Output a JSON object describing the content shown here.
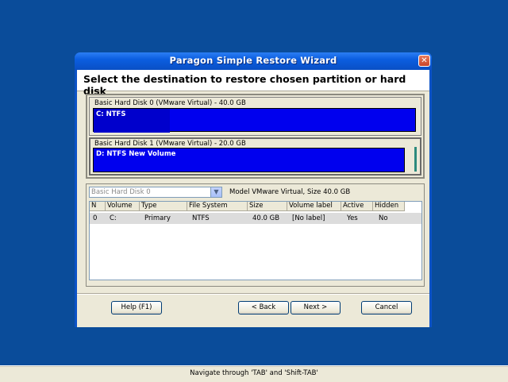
{
  "window": {
    "title": "Paragon Simple Restore Wizard",
    "close_glyph": "✕",
    "heading": "Select the destination to restore chosen partition or hard disk"
  },
  "disks": [
    {
      "label": "Basic Hard Disk 0 (VMware Virtual) - 40.0 GB",
      "partition": "C:  NTFS"
    },
    {
      "label": "Basic Hard Disk 1 (VMware Virtual) - 20.0 GB",
      "partition": "D:  NTFS New Volume"
    }
  ],
  "disk_select": {
    "value": "Basic Hard Disk 0",
    "arrow_icon": "chevron-down-icon",
    "arrow_glyph": "▼"
  },
  "model_info": "Model VMware Virtual, Size 40.0 GB",
  "table": {
    "columns": [
      "N",
      "Volume",
      "Type",
      "File System",
      "Size",
      "Volume label",
      "Active",
      "Hidden"
    ],
    "rows": [
      [
        "0",
        "C:",
        "Primary",
        "NTFS",
        "40.0 GB",
        "[No label]",
        "Yes",
        "No"
      ]
    ]
  },
  "buttons": {
    "help": "Help (F1)",
    "back": "< Back",
    "next": "Next >",
    "cancel": "Cancel"
  },
  "status_bar": "Navigate through 'TAB' and 'Shift-TAB'",
  "colors": {
    "desktop": "#0a4c9a",
    "partition": "#0000ee",
    "dialog_face": "#ece9d8"
  }
}
